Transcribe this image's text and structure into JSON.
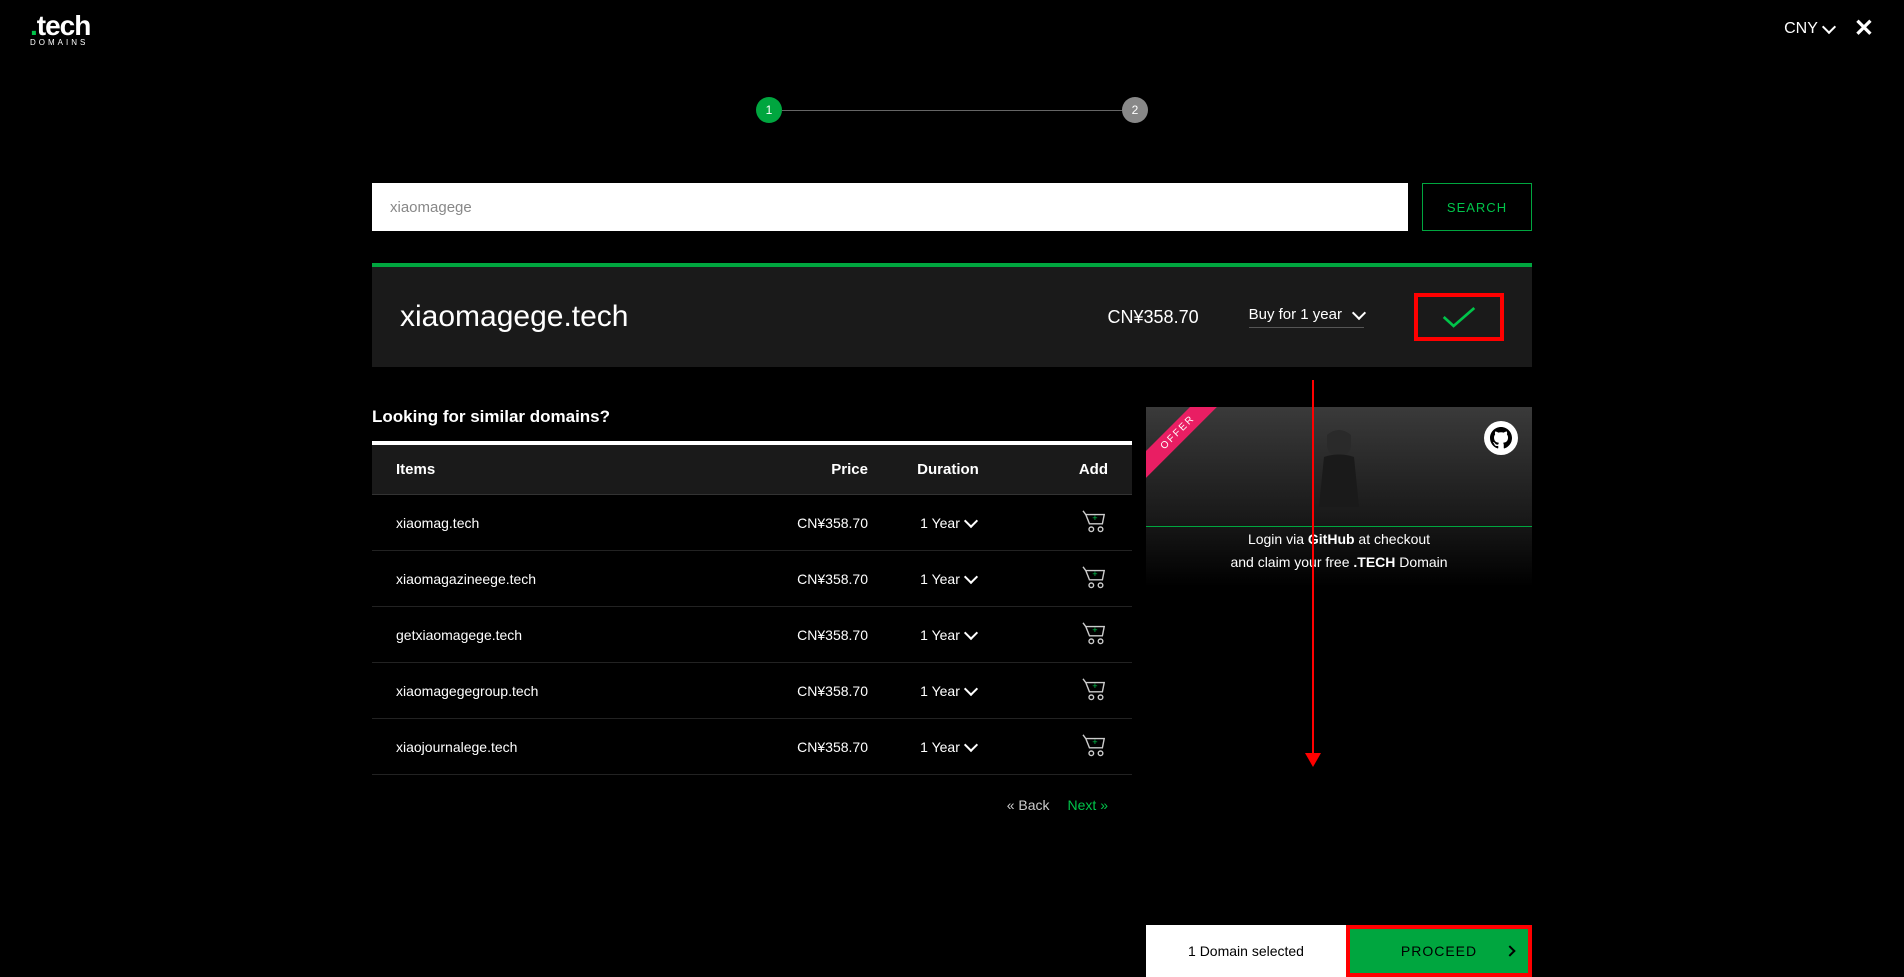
{
  "header": {
    "logo_prefix": ".",
    "logo_main": "tech",
    "logo_sub": "DOMAINS",
    "currency": "CNY"
  },
  "steps": {
    "one": "1",
    "two": "2"
  },
  "search": {
    "value": "xiaomagege",
    "button": "SEARCH"
  },
  "result": {
    "domain": "xiaomagege.tech",
    "price": "CN¥358.70",
    "buy_label": "Buy for 1 year"
  },
  "similar_heading": "Looking for similar domains?",
  "table": {
    "headers": {
      "items": "Items",
      "price": "Price",
      "duration": "Duration",
      "add": "Add"
    },
    "rows": [
      {
        "name": "xiaomag.tech",
        "price": "CN¥358.70",
        "duration": "1 Year"
      },
      {
        "name": "xiaomagazineege.tech",
        "price": "CN¥358.70",
        "duration": "1 Year"
      },
      {
        "name": "getxiaomagege.tech",
        "price": "CN¥358.70",
        "duration": "1 Year"
      },
      {
        "name": "xiaomagegegroup.tech",
        "price": "CN¥358.70",
        "duration": "1 Year"
      },
      {
        "name": "xiaojournalege.tech",
        "price": "CN¥358.70",
        "duration": "1 Year"
      }
    ],
    "back": "« Back",
    "next": "Next »"
  },
  "promo": {
    "offer": "OFFER",
    "line1_pre": "Login via ",
    "line1_bold": "GitHub",
    "line1_post": " at checkout",
    "line2_pre": "and claim your free ",
    "line2_bold": ".TECH",
    "line2_post": " Domain"
  },
  "footer": {
    "selected": "1 Domain selected",
    "proceed": "PROCEED"
  }
}
